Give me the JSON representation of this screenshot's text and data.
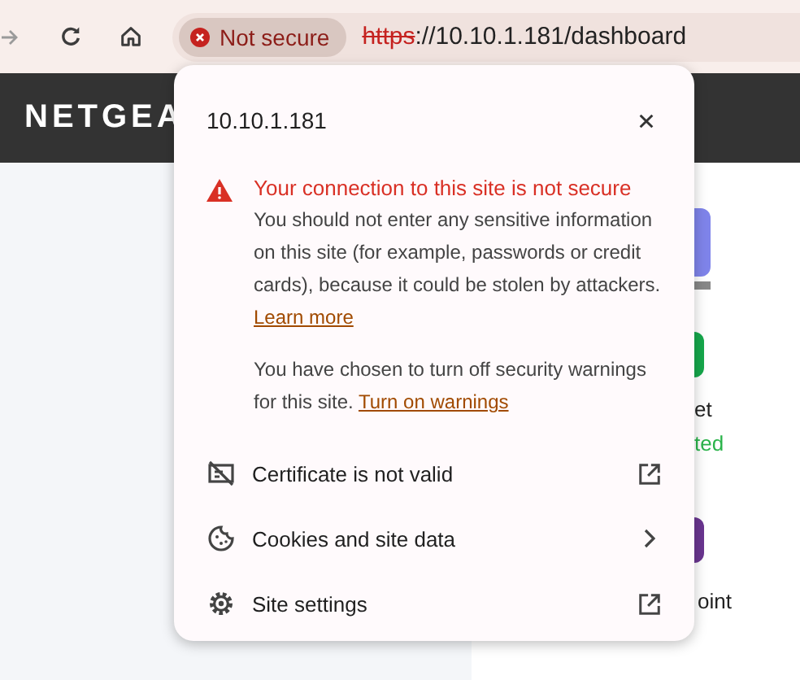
{
  "toolbar": {
    "security_chip": {
      "label": "Not secure"
    },
    "url": {
      "scheme": "https",
      "rest": "://10.10.1.181/dashboard"
    }
  },
  "header": {
    "logo": "NETGEA"
  },
  "tiles": [
    {
      "kind": "square",
      "color": "#7f84ea"
    },
    {
      "kind": "circle",
      "color": "#16a84c",
      "label": "et",
      "status": "ted"
    },
    {
      "kind": "circle",
      "color": "#6a3590",
      "label": "oint"
    }
  ],
  "popup": {
    "title": "10.10.1.181",
    "warning": {
      "title": "Your connection to this site is not secure",
      "body": "You should not enter any sensitive information on this site (for example, passwords or credit cards), because it could be stolen by attackers.",
      "link": "Learn more"
    },
    "note": {
      "text": "You have chosen to turn off security warnings for this site.",
      "link": "Turn on warnings"
    },
    "items": [
      {
        "kind": "certificate",
        "label": "Certificate is not valid",
        "trailing": {
          "kind": "external"
        }
      },
      {
        "kind": "cookies",
        "label": "Cookies and site data",
        "trailing": {
          "kind": "submenu"
        }
      },
      {
        "kind": "settings",
        "label": "Site settings",
        "trailing": {
          "kind": "external"
        }
      }
    ]
  }
}
